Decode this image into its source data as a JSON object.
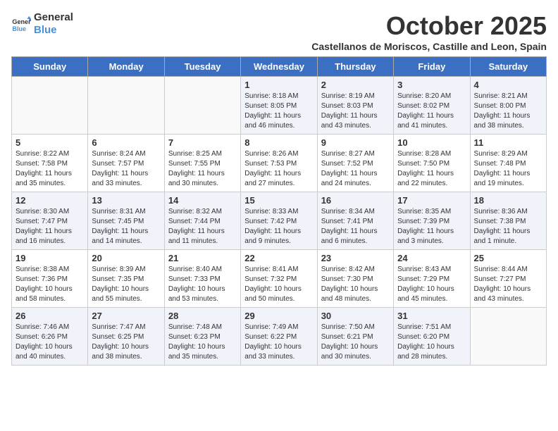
{
  "logo": {
    "line1": "General",
    "line2": "Blue"
  },
  "title": "October 2025",
  "subtitle": "Castellanos de Moriscos, Castille and Leon, Spain",
  "days_of_week": [
    "Sunday",
    "Monday",
    "Tuesday",
    "Wednesday",
    "Thursday",
    "Friday",
    "Saturday"
  ],
  "weeks": [
    [
      {
        "day": "",
        "info": ""
      },
      {
        "day": "",
        "info": ""
      },
      {
        "day": "",
        "info": ""
      },
      {
        "day": "1",
        "info": "Sunrise: 8:18 AM\nSunset: 8:05 PM\nDaylight: 11 hours and 46 minutes."
      },
      {
        "day": "2",
        "info": "Sunrise: 8:19 AM\nSunset: 8:03 PM\nDaylight: 11 hours and 43 minutes."
      },
      {
        "day": "3",
        "info": "Sunrise: 8:20 AM\nSunset: 8:02 PM\nDaylight: 11 hours and 41 minutes."
      },
      {
        "day": "4",
        "info": "Sunrise: 8:21 AM\nSunset: 8:00 PM\nDaylight: 11 hours and 38 minutes."
      }
    ],
    [
      {
        "day": "5",
        "info": "Sunrise: 8:22 AM\nSunset: 7:58 PM\nDaylight: 11 hours and 35 minutes."
      },
      {
        "day": "6",
        "info": "Sunrise: 8:24 AM\nSunset: 7:57 PM\nDaylight: 11 hours and 33 minutes."
      },
      {
        "day": "7",
        "info": "Sunrise: 8:25 AM\nSunset: 7:55 PM\nDaylight: 11 hours and 30 minutes."
      },
      {
        "day": "8",
        "info": "Sunrise: 8:26 AM\nSunset: 7:53 PM\nDaylight: 11 hours and 27 minutes."
      },
      {
        "day": "9",
        "info": "Sunrise: 8:27 AM\nSunset: 7:52 PM\nDaylight: 11 hours and 24 minutes."
      },
      {
        "day": "10",
        "info": "Sunrise: 8:28 AM\nSunset: 7:50 PM\nDaylight: 11 hours and 22 minutes."
      },
      {
        "day": "11",
        "info": "Sunrise: 8:29 AM\nSunset: 7:48 PM\nDaylight: 11 hours and 19 minutes."
      }
    ],
    [
      {
        "day": "12",
        "info": "Sunrise: 8:30 AM\nSunset: 7:47 PM\nDaylight: 11 hours and 16 minutes."
      },
      {
        "day": "13",
        "info": "Sunrise: 8:31 AM\nSunset: 7:45 PM\nDaylight: 11 hours and 14 minutes."
      },
      {
        "day": "14",
        "info": "Sunrise: 8:32 AM\nSunset: 7:44 PM\nDaylight: 11 hours and 11 minutes."
      },
      {
        "day": "15",
        "info": "Sunrise: 8:33 AM\nSunset: 7:42 PM\nDaylight: 11 hours and 9 minutes."
      },
      {
        "day": "16",
        "info": "Sunrise: 8:34 AM\nSunset: 7:41 PM\nDaylight: 11 hours and 6 minutes."
      },
      {
        "day": "17",
        "info": "Sunrise: 8:35 AM\nSunset: 7:39 PM\nDaylight: 11 hours and 3 minutes."
      },
      {
        "day": "18",
        "info": "Sunrise: 8:36 AM\nSunset: 7:38 PM\nDaylight: 11 hours and 1 minute."
      }
    ],
    [
      {
        "day": "19",
        "info": "Sunrise: 8:38 AM\nSunset: 7:36 PM\nDaylight: 10 hours and 58 minutes."
      },
      {
        "day": "20",
        "info": "Sunrise: 8:39 AM\nSunset: 7:35 PM\nDaylight: 10 hours and 55 minutes."
      },
      {
        "day": "21",
        "info": "Sunrise: 8:40 AM\nSunset: 7:33 PM\nDaylight: 10 hours and 53 minutes."
      },
      {
        "day": "22",
        "info": "Sunrise: 8:41 AM\nSunset: 7:32 PM\nDaylight: 10 hours and 50 minutes."
      },
      {
        "day": "23",
        "info": "Sunrise: 8:42 AM\nSunset: 7:30 PM\nDaylight: 10 hours and 48 minutes."
      },
      {
        "day": "24",
        "info": "Sunrise: 8:43 AM\nSunset: 7:29 PM\nDaylight: 10 hours and 45 minutes."
      },
      {
        "day": "25",
        "info": "Sunrise: 8:44 AM\nSunset: 7:27 PM\nDaylight: 10 hours and 43 minutes."
      }
    ],
    [
      {
        "day": "26",
        "info": "Sunrise: 7:46 AM\nSunset: 6:26 PM\nDaylight: 10 hours and 40 minutes."
      },
      {
        "day": "27",
        "info": "Sunrise: 7:47 AM\nSunset: 6:25 PM\nDaylight: 10 hours and 38 minutes."
      },
      {
        "day": "28",
        "info": "Sunrise: 7:48 AM\nSunset: 6:23 PM\nDaylight: 10 hours and 35 minutes."
      },
      {
        "day": "29",
        "info": "Sunrise: 7:49 AM\nSunset: 6:22 PM\nDaylight: 10 hours and 33 minutes."
      },
      {
        "day": "30",
        "info": "Sunrise: 7:50 AM\nSunset: 6:21 PM\nDaylight: 10 hours and 30 minutes."
      },
      {
        "day": "31",
        "info": "Sunrise: 7:51 AM\nSunset: 6:20 PM\nDaylight: 10 hours and 28 minutes."
      },
      {
        "day": "",
        "info": ""
      }
    ]
  ]
}
